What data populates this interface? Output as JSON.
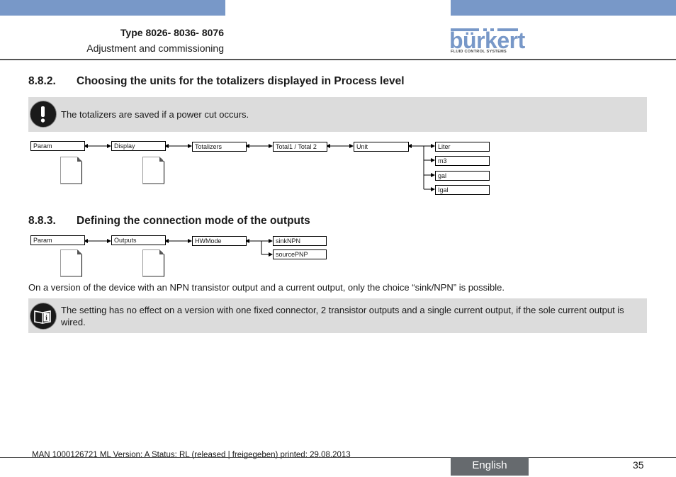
{
  "header": {
    "title": "Type 8026- 8036- 8076",
    "subtitle": "Adjustment and commissioning",
    "logo": {
      "wordmark": "bürkert",
      "tagline": "FLUID CONTROL SYSTEMS"
    },
    "accent_color": "#7898c8"
  },
  "sections": [
    {
      "number": "8.8.2.",
      "title": "Choosing the units for the totalizers displayed in Process level",
      "note": {
        "icon": "warning-exclamation-icon",
        "text": "The totalizers are saved if a power cut occurs."
      },
      "menu_path": [
        "Param",
        "Display",
        "Totalizers",
        "Total1 / Total 2",
        "Unit"
      ],
      "options": [
        "Liter",
        "m3",
        "gal",
        "Igal"
      ]
    },
    {
      "number": "8.8.3.",
      "title": "Defining the connection mode of the outputs",
      "menu_path": [
        "Param",
        "Outputs",
        "HWMode"
      ],
      "options": [
        "sinkNPN",
        "sourcePNP"
      ],
      "paragraph": "On a version of the device with an NPN transistor output and a current output, only the choice “sink/NPN” is possible.",
      "note": {
        "icon": "info-book-icon",
        "text": "The setting has no effect on a version with one fixed connector, 2 transistor outputs and a single current output, if the sole current output is wired."
      }
    }
  ],
  "footer": {
    "doc_info": "MAN  1000126721  ML  Version: A Status: RL (released | freigegeben)  printed: 29.08.2013",
    "language": "English",
    "page_number": "35"
  }
}
